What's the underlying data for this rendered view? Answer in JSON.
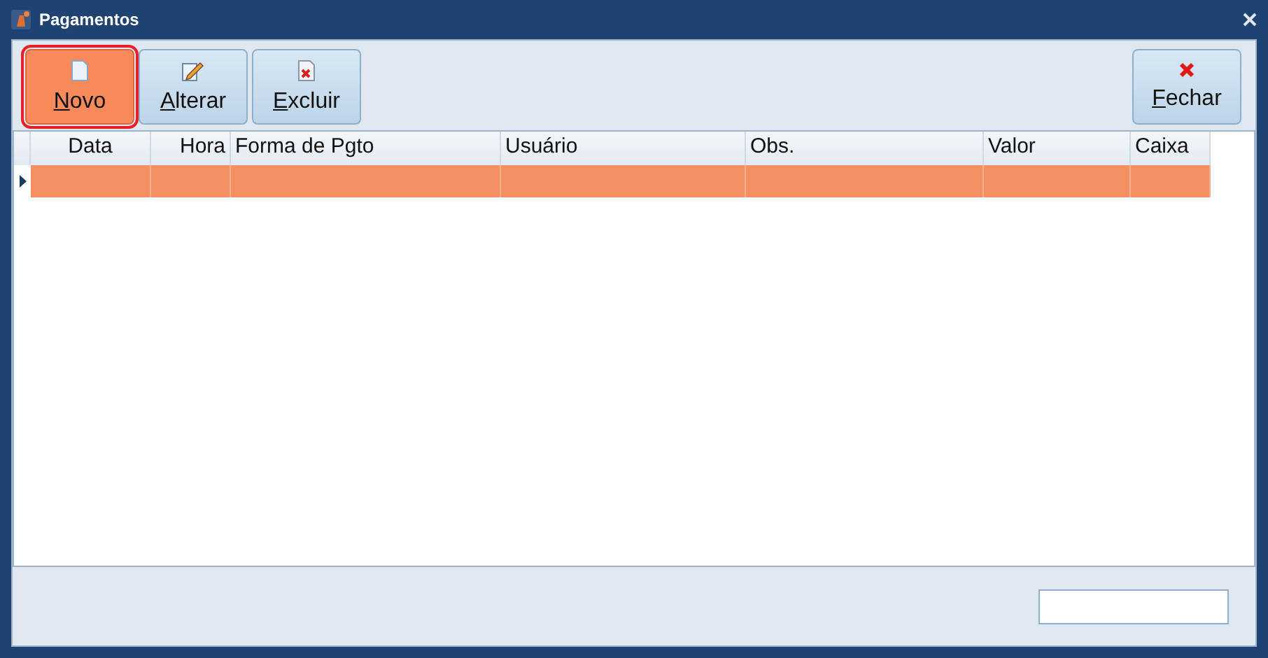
{
  "window": {
    "title": "Pagamentos"
  },
  "toolbar": [
    {
      "label": "Novo",
      "kind": "new",
      "selected": true
    },
    {
      "label": "Alterar",
      "kind": "edit",
      "selected": false
    },
    {
      "label": "Excluir",
      "kind": "delete",
      "selected": false
    }
  ],
  "close_button": {
    "label": "Fechar"
  },
  "table": {
    "columns": [
      "Data",
      "Hora",
      "Forma de Pgto",
      "Usuário",
      "Obs.",
      "Valor",
      "Caixa"
    ],
    "rows": [
      {
        "selected": true
      }
    ]
  }
}
